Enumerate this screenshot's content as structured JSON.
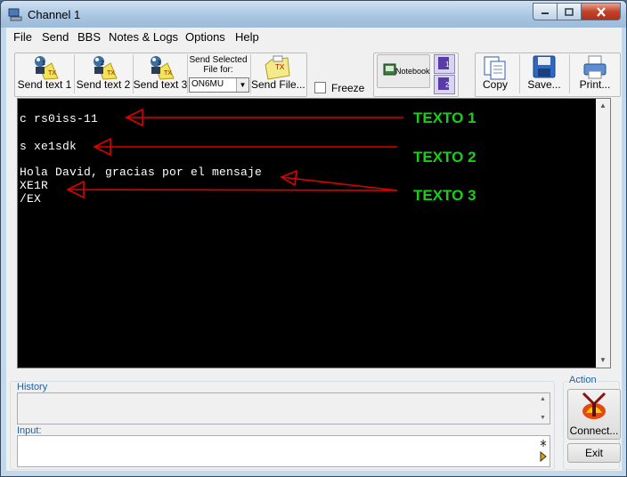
{
  "window": {
    "title": "Channel 1"
  },
  "menu": [
    "File",
    "Send",
    "BBS",
    "Notes & Logs",
    "Options",
    "Help"
  ],
  "toolbar": {
    "send_text_1": "Send text 1",
    "send_text_2": "Send text 2",
    "send_text_3": "Send text 3",
    "send_selected_file_for": "Send Selected File for:",
    "file_for_value": "ON6MU",
    "send_file": "Send File...",
    "freeze": "Freeze",
    "notebook": "Notebook",
    "copy": "Copy",
    "save": "Save...",
    "print": "Print..."
  },
  "terminal": {
    "lines": [
      "c rs0iss-11",
      "s xe1sdk",
      "Hola David, gracias por el mensaje",
      "XE1R",
      "/EX"
    ],
    "annotations": [
      "TEXTO 1",
      "TEXTO 2",
      "TEXTO 3"
    ]
  },
  "history": {
    "label": "History"
  },
  "input": {
    "label": "Input:"
  },
  "action": {
    "label": "Action",
    "connect": "Connect...",
    "exit": "Exit"
  },
  "colors": {
    "terminal_bg": "#000000",
    "terminal_text": "#ffffff",
    "annotation_text": "#17d117",
    "arrow": "#e00000"
  },
  "icons": [
    "app-icon",
    "minimize-icon",
    "maximize-icon",
    "close-icon",
    "send-text-icon",
    "send-file-icon",
    "notebook-icon",
    "copy-icon",
    "save-icon",
    "print-icon",
    "connect-icon"
  ]
}
